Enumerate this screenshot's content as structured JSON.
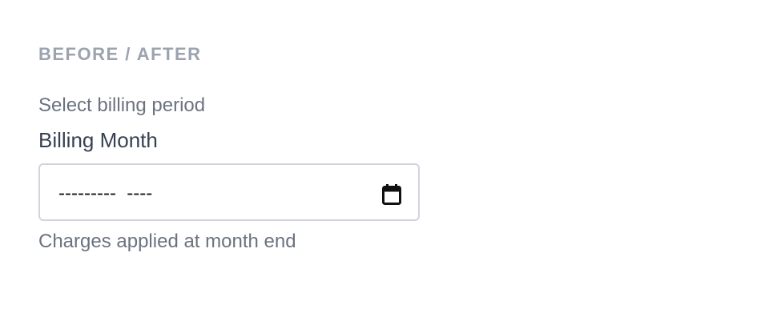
{
  "section": {
    "heading": "BEFORE / AFTER"
  },
  "field": {
    "helper_text": "Select billing period",
    "label": "Billing Month",
    "value_display": "---------  ----",
    "hint": "Charges applied at month end",
    "picker_icon": "calendar-icon"
  },
  "colors": {
    "heading": "#9ca3af",
    "muted_text": "#6b7280",
    "label_text": "#374151",
    "input_border": "#d1d5db"
  }
}
